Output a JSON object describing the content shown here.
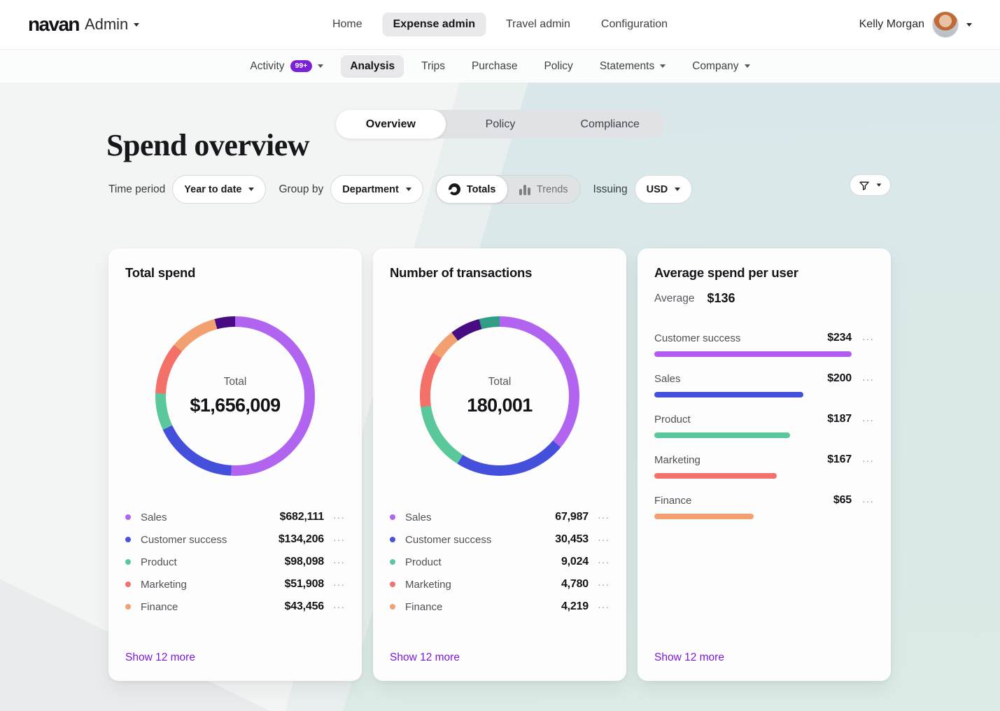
{
  "colors": {
    "accent_purple": "#7a1ad6",
    "badge_purple": "#7b1fd9",
    "active_pill_gray": "#e9e9ec",
    "teal_background": "#dbe8ea",
    "page_background": "#f3f5f5",
    "card_background": "#fdfdfe"
  },
  "header": {
    "brand": "navan",
    "product": "Admin",
    "nav": [
      {
        "label": "Home",
        "active": false
      },
      {
        "label": "Expense admin",
        "active": true
      },
      {
        "label": "Travel admin",
        "active": false
      },
      {
        "label": "Configuration",
        "active": false
      }
    ],
    "user_name": "Kelly Morgan"
  },
  "subnav": [
    {
      "label": "Activity",
      "badge": "99+",
      "caret": true,
      "active": false
    },
    {
      "label": "Analysis",
      "active": true
    },
    {
      "label": "Trips",
      "active": false
    },
    {
      "label": "Purchase",
      "active": false
    },
    {
      "label": "Policy",
      "active": false
    },
    {
      "label": "Statements",
      "caret": true,
      "active": false
    },
    {
      "label": "Company",
      "caret": true,
      "active": false
    }
  ],
  "tabs": [
    {
      "label": "Overview",
      "active": true
    },
    {
      "label": "Policy",
      "active": false
    },
    {
      "label": "Compliance",
      "active": false
    }
  ],
  "page": {
    "title": "Spend overview"
  },
  "filters": {
    "time_period_label": "Time period",
    "time_period_value": "Year to date",
    "group_by_label": "Group by",
    "group_by_value": "Department",
    "view_toggle": [
      {
        "label": "Totals",
        "icon": "donut-chart-icon",
        "active": true
      },
      {
        "label": "Trends",
        "icon": "bar-chart-icon",
        "active": false
      }
    ],
    "issuing_label": "Issuing",
    "issuing_value": "USD"
  },
  "misc": {
    "more_options_glyph": "···"
  },
  "chart_data": [
    {
      "type": "donut",
      "title": "Total spend",
      "center_label": "Total",
      "center_value": "$1,656,009",
      "total": 1656009,
      "legend": [
        {
          "label": "Sales",
          "value": 682111,
          "display": "$682,111",
          "color": "#b164ef"
        },
        {
          "label": "Customer success",
          "value": 134206,
          "display": "$134,206",
          "color": "#4b50dc"
        },
        {
          "label": "Product",
          "value": 98098,
          "display": "$98,098",
          "color": "#5bc89c"
        },
        {
          "label": "Marketing",
          "value": 51908,
          "display": "$51,908",
          "color": "#f4716a"
        },
        {
          "label": "Finance",
          "value": 43456,
          "display": "$43,456",
          "color": "#f2a070"
        }
      ],
      "segments": [
        {
          "color": "#b164ef",
          "from": 0,
          "to": 183
        },
        {
          "color": "#4450dc",
          "from": 183,
          "to": 245
        },
        {
          "color": "#5bc89c",
          "from": 245,
          "to": 272
        },
        {
          "color": "#f4716a",
          "from": 272,
          "to": 310
        },
        {
          "color": "#f2a070",
          "from": 310,
          "to": 345
        },
        {
          "color": "#470c82",
          "from": 345,
          "to": 360
        }
      ],
      "more_label": "Show 12 more"
    },
    {
      "type": "donut",
      "title": "Number of transactions",
      "center_label": "Total",
      "center_value": "180,001",
      "total": 180001,
      "legend": [
        {
          "label": "Sales",
          "value": 67987,
          "display": "67,987",
          "color": "#b164ef"
        },
        {
          "label": "Customer success",
          "value": 30453,
          "display": "30,453",
          "color": "#4b50dc"
        },
        {
          "label": "Product",
          "value": 9024,
          "display": "9,024",
          "color": "#5bc89c"
        },
        {
          "label": "Marketing",
          "value": 4780,
          "display": "4,780",
          "color": "#f4716a"
        },
        {
          "label": "Finance",
          "value": 4219,
          "display": "4,219",
          "color": "#f2a070"
        }
      ],
      "segments": [
        {
          "color": "#b164ef",
          "from": 0,
          "to": 130
        },
        {
          "color": "#4450dc",
          "from": 130,
          "to": 212
        },
        {
          "color": "#5bc89c",
          "from": 212,
          "to": 262
        },
        {
          "color": "#f4716a",
          "from": 262,
          "to": 303
        },
        {
          "color": "#f2a070",
          "from": 303,
          "to": 323
        },
        {
          "color": "#470c82",
          "from": 323,
          "to": 345
        },
        {
          "color": "#2f9e85",
          "from": 345,
          "to": 360
        }
      ],
      "more_label": "Show 12 more"
    },
    {
      "type": "bar",
      "title": "Average spend per user",
      "average_label": "Average",
      "average_value": "$136",
      "bars": [
        {
          "label": "Customer success",
          "value": 234,
          "display": "$234",
          "pct": 100,
          "color": "#b05cf0"
        },
        {
          "label": "Sales",
          "value": 200,
          "display": "$200",
          "pct": 75.7,
          "color": "#4450dc"
        },
        {
          "label": "Product",
          "value": 187,
          "display": "$187",
          "pct": 68.9,
          "color": "#5bc89c"
        },
        {
          "label": "Marketing",
          "value": 167,
          "display": "$167",
          "pct": 62.1,
          "color": "#f4716a"
        },
        {
          "label": "Finance",
          "value": 65,
          "display": "$65",
          "pct": 50.4,
          "color": "#f2a070"
        }
      ],
      "more_label": "Show 12 more"
    }
  ]
}
